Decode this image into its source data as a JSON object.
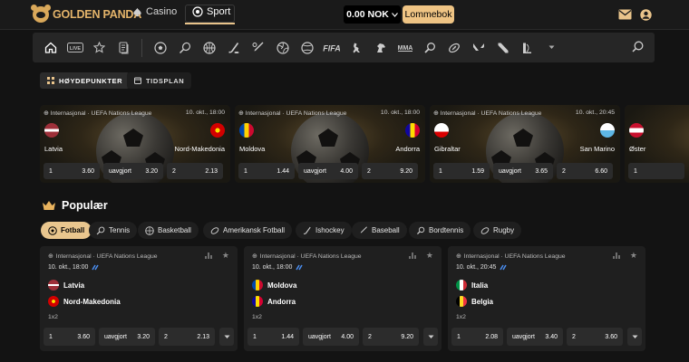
{
  "header": {
    "brand": "GOLDEN PANDA",
    "casino_label": "Casino",
    "sport_label": "Sport",
    "balance": "0.00 NOK",
    "wallet_label": "Lommebok",
    "accent_color": "#efc484"
  },
  "sportbar": {
    "icons": [
      "home-icon",
      "live-icon",
      "star-icon",
      "betslip-icon",
      "football-icon",
      "tennis-icon",
      "basketball-icon",
      "hockey-icon",
      "baseball-icon",
      "volleyball-icon",
      "handball-icon",
      "fifa-icon",
      "counter-strike-icon",
      "horse-racing-icon",
      "mma-icon",
      "table-tennis-icon",
      "rugby-icon",
      "valorant-icon",
      "dota-icon",
      "league-icon"
    ]
  },
  "subtabs": {
    "highlights": "HØYDEPUNKTER",
    "schedule": "TIDSPLAN"
  },
  "highlights": [
    {
      "league": "Internasjonal · UEFA Nations League",
      "time": "10. okt., 18:00",
      "home": "Latvia",
      "away": "Nord-Makedonia",
      "o1": "3.60",
      "ox_label": "uavgjort",
      "ox": "3.20",
      "o2_label": "2",
      "o2": "2.13",
      "o1_label": "1"
    },
    {
      "league": "Internasjonal · UEFA Nations League",
      "time": "10. okt., 18:00",
      "home": "Moldova",
      "away": "Andorra",
      "o1": "1.44",
      "ox_label": "uavgjort",
      "ox": "4.00",
      "o2_label": "2",
      "o2": "9.20",
      "o1_label": "1"
    },
    {
      "league": "Internasjonal · UEFA Nations League",
      "time": "10. okt., 20:45",
      "home": "Gibraltar",
      "away": "San Marino",
      "o1": "1.59",
      "ox_label": "uavgjort",
      "ox": "3.65",
      "o2_label": "2",
      "o2": "6.60",
      "o1_label": "1"
    },
    {
      "home": "Øster",
      "o1_label": "1"
    }
  ],
  "popular": {
    "title": "Populær",
    "chips": [
      "Fotball",
      "Tennis",
      "Basketball",
      "Amerikansk Fotball",
      "Ishockey",
      "Baseball",
      "Bordtennis",
      "Rugby"
    ]
  },
  "matches": [
    {
      "league": "Internasjonal · UEFA Nations League",
      "date": "10. okt., 18:00",
      "home": "Latvia",
      "away": "Nord-Makedonia",
      "market": "1x2",
      "o1_label": "1",
      "o1": "3.60",
      "ox_label": "uavgjort",
      "ox": "3.20",
      "o2_label": "2",
      "o2": "2.13"
    },
    {
      "league": "Internasjonal · UEFA Nations League",
      "date": "10. okt., 18:00",
      "home": "Moldova",
      "away": "Andorra",
      "market": "1x2",
      "o1_label": "1",
      "o1": "1.44",
      "ox_label": "uavgjort",
      "ox": "4.00",
      "o2_label": "2",
      "o2": "9.20"
    },
    {
      "league": "Internasjonal · UEFA Nations League",
      "date": "10. okt., 20:45",
      "home": "Italia",
      "away": "Belgia",
      "market": "1x2",
      "o1_label": "1",
      "o1": "2.08",
      "ox_label": "uavgjort",
      "ox": "3.40",
      "o2_label": "2",
      "o2": "3.60"
    }
  ]
}
